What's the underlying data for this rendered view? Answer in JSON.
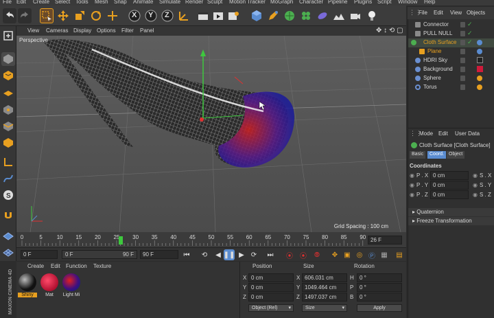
{
  "menubar": [
    "File",
    "Edit",
    "Create",
    "Select",
    "Tools",
    "Mesh",
    "Snap",
    "Animate",
    "Simulate",
    "Render",
    "Sculpt",
    "Motion Tracker",
    "MoGraph",
    "Character",
    "Pipeline",
    "Plugins",
    "Script",
    "Window",
    "Help"
  ],
  "toolbar": {
    "axes": [
      "X",
      "Y",
      "Z"
    ],
    "icons": [
      "undo-icon",
      "redo-icon",
      "live-selection-icon",
      "move-icon",
      "scale-icon",
      "rotate-icon",
      "recent-tools-icon",
      "x-axis-icon",
      "y-axis-icon",
      "z-axis-icon",
      "world-coordinates-icon",
      "render-view-icon",
      "render-to-picture-viewer-icon",
      "edit-render-settings-icon",
      "cube-icon",
      "pen-icon",
      "subdivision-surface-icon",
      "cloner-icon",
      "deformer-icon",
      "scene-icon",
      "camera-icon",
      "light-icon"
    ]
  },
  "viewport": {
    "menu": [
      "View",
      "Cameras",
      "Display",
      "Options",
      "Filter",
      "Panel"
    ],
    "label": "Perspective",
    "grid_spacing": "Grid Spacing : 100 cm"
  },
  "timeline": {
    "ticks": [
      "0",
      "5",
      "10",
      "15",
      "20",
      "25",
      "30",
      "35",
      "40",
      "45",
      "50",
      "55",
      "60",
      "65",
      "70",
      "75",
      "80",
      "85",
      "90"
    ],
    "current_frame": "26 F",
    "playhead_frame": 26
  },
  "playbar": {
    "start_field": "0 F",
    "range_start": "0 F",
    "range_end": "90 F",
    "end_field": "90 F"
  },
  "material_manager": {
    "menu": [
      "Create",
      "Edit",
      "Function",
      "Texture"
    ],
    "materials": [
      {
        "name": "Shiny",
        "color": "#1a1a1a",
        "selected": true
      },
      {
        "name": "Mat",
        "color": "#d01a3a",
        "selected": false
      },
      {
        "name": "Light Mi",
        "color": "#2a1a40",
        "selected": false
      }
    ]
  },
  "coordinates": {
    "headers": [
      "Position",
      "Size",
      "Rotation"
    ],
    "rows": [
      {
        "axis": "X",
        "pos": "0 cm",
        "size_axis": "X",
        "size": "606.031 cm",
        "rot_axis": "H",
        "rot": "0 °"
      },
      {
        "axis": "Y",
        "pos": "0 cm",
        "size_axis": "Y",
        "size": "1049.464 cm",
        "rot_axis": "P",
        "rot": "0 °"
      },
      {
        "axis": "Z",
        "pos": "0 cm",
        "size_axis": "Z",
        "size": "1497.037 cm",
        "rot_axis": "B",
        "rot": "0 °"
      }
    ],
    "mode_select": "Object (Rel)",
    "size_select": "Size",
    "apply_label": "Apply"
  },
  "object_manager": {
    "menu": [
      "File",
      "Edit",
      "View",
      "Objects"
    ],
    "objects": [
      {
        "name": "Connector",
        "indent": 0,
        "color": "#8a8a8a",
        "highlight": false
      },
      {
        "name": "PULL NULL",
        "indent": 0,
        "color": "#8a8a8a",
        "highlight": false
      },
      {
        "name": "Cloth Surface",
        "indent": 0,
        "color": "#4caf50",
        "highlight": true
      },
      {
        "name": "Plane",
        "indent": 1,
        "color": "#e8a020",
        "highlight": true
      },
      {
        "name": "HDRI Sky",
        "indent": 0,
        "color": "#6a8fd0",
        "highlight": false
      },
      {
        "name": "Background",
        "indent": 0,
        "color": "#6a8fd0",
        "highlight": false
      },
      {
        "name": "Sphere",
        "indent": 0,
        "color": "#6a8fd0",
        "highlight": false
      },
      {
        "name": "Torus",
        "indent": 0,
        "color": "#6a8fd0",
        "highlight": false
      }
    ]
  },
  "attributes": {
    "menu": [
      "Mode",
      "Edit",
      "User Data"
    ],
    "title": "Cloth Surface [Cloth Surface]",
    "tabs": [
      "Basic",
      "Coord.",
      "Object"
    ],
    "active_tab": "Coord.",
    "section": "Coordinates",
    "rows": [
      {
        "label": "P . X",
        "value": "0 cm",
        "right": "S . X"
      },
      {
        "label": "P . Y",
        "value": "0 cm",
        "right": "S . Y"
      },
      {
        "label": "P . Z",
        "value": "0 cm",
        "right": "S . Z"
      }
    ],
    "collapsed": [
      "Quaternion",
      "Freeze Transformation"
    ]
  },
  "brand": "MAXON CINEMA 4D",
  "colors": {
    "accent_orange": "#e8a020",
    "accent_blue": "#5a8cd0",
    "highlight_green": "#4caf50"
  }
}
